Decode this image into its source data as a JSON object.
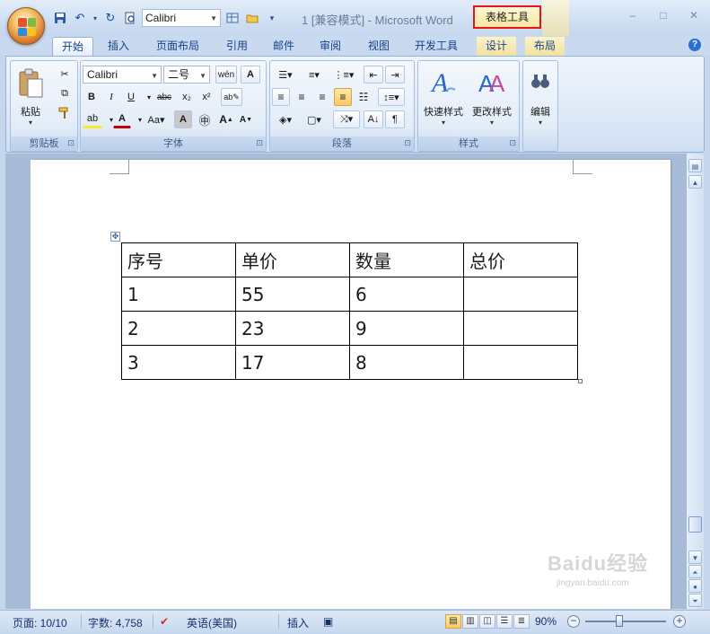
{
  "window": {
    "title": "1 [兼容模式] - Microsoft Word",
    "context_tab_title": "表格工具",
    "controls": [
      "–",
      "□",
      "✕"
    ]
  },
  "quick_access": {
    "font_value": "Calibri"
  },
  "tabs": [
    {
      "label": "开始",
      "active": true
    },
    {
      "label": "插入"
    },
    {
      "label": "页面布局"
    },
    {
      "label": "引用"
    },
    {
      "label": "邮件"
    },
    {
      "label": "审阅"
    },
    {
      "label": "视图"
    },
    {
      "label": "开发工具"
    },
    {
      "label": "设计"
    },
    {
      "label": "布局"
    }
  ],
  "ribbon": {
    "clipboard": {
      "label": "剪贴板",
      "paste": "粘贴"
    },
    "font": {
      "label": "字体",
      "font_name": "Calibri",
      "font_size": "二号"
    },
    "paragraph": {
      "label": "段落"
    },
    "styles": {
      "label": "样式",
      "quick_styles": "快速样式",
      "change_styles": "更改样式"
    },
    "editing": {
      "label": "编辑"
    }
  },
  "document": {
    "table": [
      [
        "序号",
        "单价",
        "数量",
        "总价"
      ],
      [
        "1",
        "55",
        "6",
        ""
      ],
      [
        "2",
        "23",
        "9",
        ""
      ],
      [
        "3",
        "17",
        "8",
        ""
      ]
    ],
    "watermark": "Baidu经验",
    "watermark_sub": "jingyan.baidu.com"
  },
  "statusbar": {
    "page": "页面: 10/10",
    "words": "字数: 4,758",
    "language": "英语(美国)",
    "mode": "插入",
    "zoom": "90%"
  },
  "colors": {
    "context_highlight": "#e8131c",
    "ribbon_text": "#15428b"
  }
}
